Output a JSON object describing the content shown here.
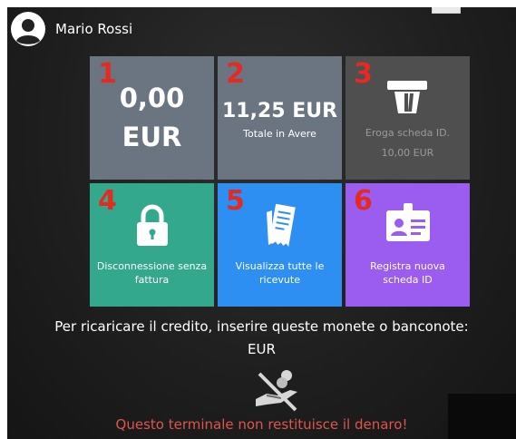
{
  "user": {
    "name": "Mario Rossi"
  },
  "tiles": [
    {
      "number": "1",
      "amount": "0,00 EUR"
    },
    {
      "number": "2",
      "amount": "11,25 EUR",
      "subtitle": "Totale in Avere"
    },
    {
      "number": "3",
      "label": "Eroga scheda ID.",
      "price": "10,00 EUR",
      "icon": "card-dispense-icon"
    },
    {
      "number": "4",
      "label": "Disconnessione senza fattura",
      "icon": "lock-icon"
    },
    {
      "number": "5",
      "label": "Visualizza tutte le ricevute",
      "icon": "receipts-icon"
    },
    {
      "number": "6",
      "label": "Registra nuova scheda ID",
      "icon": "id-card-icon"
    }
  ],
  "info": {
    "recharge_text": "Per ricaricare il credito, inserire queste monete o banconote:",
    "currency": "EUR",
    "no_change_icon": "no-cash-icon",
    "warning": "Questo terminale non restituisce il denaro!"
  },
  "colors": {
    "tile_gray": "#6b7481",
    "tile_disabled": "#4f4f4f",
    "tile_green": "#33a88c",
    "tile_blue": "#2d8ff2",
    "tile_purple": "#9a5df0",
    "number_red": "#e32a23",
    "warning_red": "#e0544b"
  }
}
